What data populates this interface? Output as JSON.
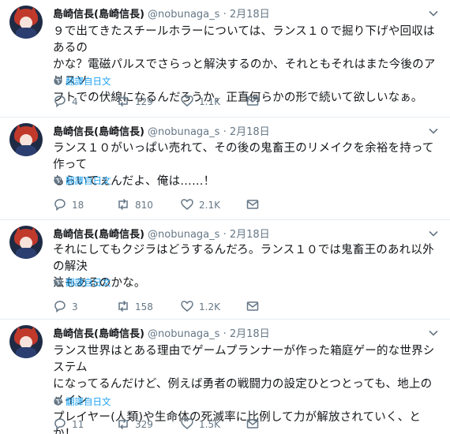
{
  "tweets": [
    {
      "name": "島崎信長(島崎信長)",
      "handle": "@nobunaga_s",
      "date": "2月18日",
      "text_lines": [
        "９で出てきたスチールホラーについては、ランス１０で掘り下げや回収はあるの",
        "かな？電磁パルスでさらっと解決するのか、それともそれはまた今後のアリスソ",
        "フトでの伏線になるんだろうか。正直何らかの形で続いて欲しいなぁ。"
      ],
      "translate_label": "翻譯自日文",
      "replies": "4",
      "retweets": "129",
      "likes": "1.1K"
    },
    {
      "name": "島崎信長(島崎信長)",
      "handle": "@nobunaga_s",
      "date": "2月18日",
      "text_lines": [
        "ランス１０がいっぱい売れて、その後の鬼畜王のリメイクを余裕を持って作って",
        "もらいてぇんだよ、俺は……！"
      ],
      "translate_label": "翻譯自日文",
      "replies": "18",
      "retweets": "810",
      "likes": "2.1K"
    },
    {
      "name": "島崎信長(島崎信長)",
      "handle": "@nobunaga_s",
      "date": "2月18日",
      "text_lines": [
        "それにしてもクジラはどうするんだろ。ランス１０では鬼畜王のあれ以外の解決",
        "法もあるのかな。"
      ],
      "translate_label": "翻譯自日文",
      "replies": "3",
      "retweets": "158",
      "likes": "1.2K"
    },
    {
      "name": "島崎信長(島崎信長)",
      "handle": "@nobunaga_s",
      "date": "2月18日",
      "text_lines": [
        "ランス世界はとある理由でゲームプランナーが作った箱庭ゲー的な世界システム",
        "になってるんだけど、例えば勇者の戦闘力の設定ひとつとっても、地上のメイン",
        "プレイヤー(人類)や生命体の死滅率に比例して力が解放されていく、とか！"
      ],
      "translate_label": "翻譯自日文",
      "replies": "11",
      "retweets": "329",
      "likes": "1.5K"
    }
  ],
  "colors": {
    "link": "#1da1f2",
    "muted": "#657786",
    "divider": "#e6ecf0"
  },
  "icons": [
    "chevron-down-icon",
    "globe-icon",
    "reply-icon",
    "retweet-icon",
    "like-icon",
    "direct-message-icon"
  ]
}
